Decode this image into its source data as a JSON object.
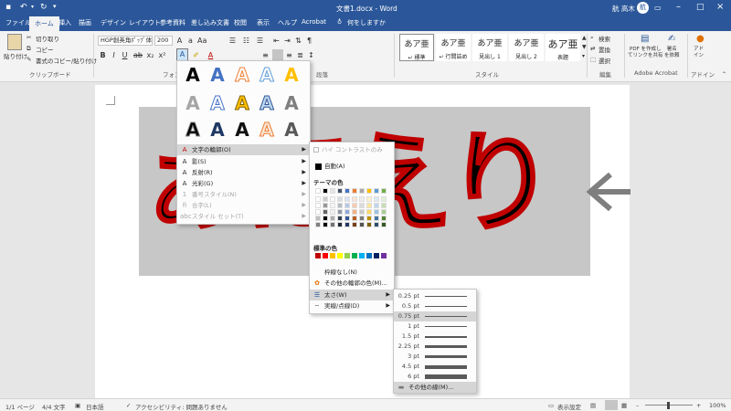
{
  "titlebar": {
    "doc_title": "文書1.docx - Word",
    "user": "航 高木",
    "user_initial": "航",
    "save_icon": "save-icon",
    "undo_icon": "undo-icon",
    "redo_icon": "redo-icon",
    "customize_icon": "customize-icon"
  },
  "tabs": [
    "ファイル",
    "ホーム",
    "挿入",
    "描画",
    "デザイン",
    "レイアウト",
    "参考資料",
    "差し込み文書",
    "校閲",
    "表示",
    "ヘルプ",
    "Acrobat"
  ],
  "active_tab": "ホーム",
  "tell_me": "何をしますか",
  "ribbon": {
    "clipboard": {
      "paste": "貼り付け",
      "cut": "切り取り",
      "copy": "コピー",
      "format_painter": "書式のコピー/貼り付け",
      "group_label": "クリップボード"
    },
    "font": {
      "font_name": "HGP創英角ﾎﾟｯﾌﾟ体",
      "font_size": "200",
      "group_label": "フォント"
    },
    "paragraph": {
      "group_label": "段落"
    },
    "styles": {
      "items": [
        {
          "sample": "あア亜",
          "label": "↵ 標準"
        },
        {
          "sample": "あア亜",
          "label": "↵ 行間詰め"
        },
        {
          "sample": "あア亜",
          "label": "見出し 1"
        },
        {
          "sample": "あア亜",
          "label": "見出し 2"
        },
        {
          "sample": "あア亜",
          "label": "表題"
        }
      ],
      "group_label": "スタイル"
    },
    "editing": {
      "find": "検索",
      "replace": "置換",
      "select": "選択",
      "group_label": "編集"
    },
    "acrobat": {
      "pdf_share": "PDF を作成し\nてリンクを共有",
      "sign": "署名\nを依頼",
      "group_label": "Adobe Acrobat"
    },
    "addins": {
      "label": "アド\nイン",
      "group_label": "アドイン"
    }
  },
  "document": {
    "text_visible": "ぁほえり",
    "fill_color": "#000000",
    "outline_color": "#c00000",
    "box_color": "#c7c7c7"
  },
  "effects_menu": {
    "outline": "文字の輪郭(O)",
    "shadow": "影(S)",
    "reflection": "反射(R)",
    "glow": "光彩(G)",
    "number_style": "番号スタイル(N)",
    "ligatures": "合字(L)",
    "stylistic_sets": "スタイル セット(T)"
  },
  "outline_menu": {
    "high_contrast": "ハイ コントラストのみ",
    "automatic": "自動(A)",
    "theme_colors_title": "テーマの色",
    "theme_colors": [
      "#ffffff",
      "#000000",
      "#e7e6e6",
      "#44546a",
      "#4472c4",
      "#ed7d31",
      "#a5a5a5",
      "#ffc000",
      "#5b9bd5",
      "#70ad47"
    ],
    "standard_colors_title": "標準の色",
    "standard_colors": [
      "#c00000",
      "#ff0000",
      "#ffc000",
      "#ffff00",
      "#92d050",
      "#00b050",
      "#00b0f0",
      "#0070c0",
      "#002060",
      "#7030a0"
    ],
    "no_outline": "枠線なし(N)",
    "more_colors": "その他の輪郭の色(M)...",
    "weight": "太さ(W)",
    "dashes": "実線/点線(D)"
  },
  "weight_menu": {
    "weights": [
      "0.25 pt",
      "0.5 pt",
      "0.75 pt",
      "1 pt",
      "1.5 pt",
      "2.25 pt",
      "3 pt",
      "4.5 pt",
      "6 pt"
    ],
    "more_lines": "その他の線(M)..."
  },
  "status": {
    "page": "1/1 ページ",
    "words": "4/4 文字",
    "language": "日本語",
    "accessibility": "アクセシビリティ: 問題ありません",
    "display_settings": "表示設定",
    "zoom": "100%"
  }
}
